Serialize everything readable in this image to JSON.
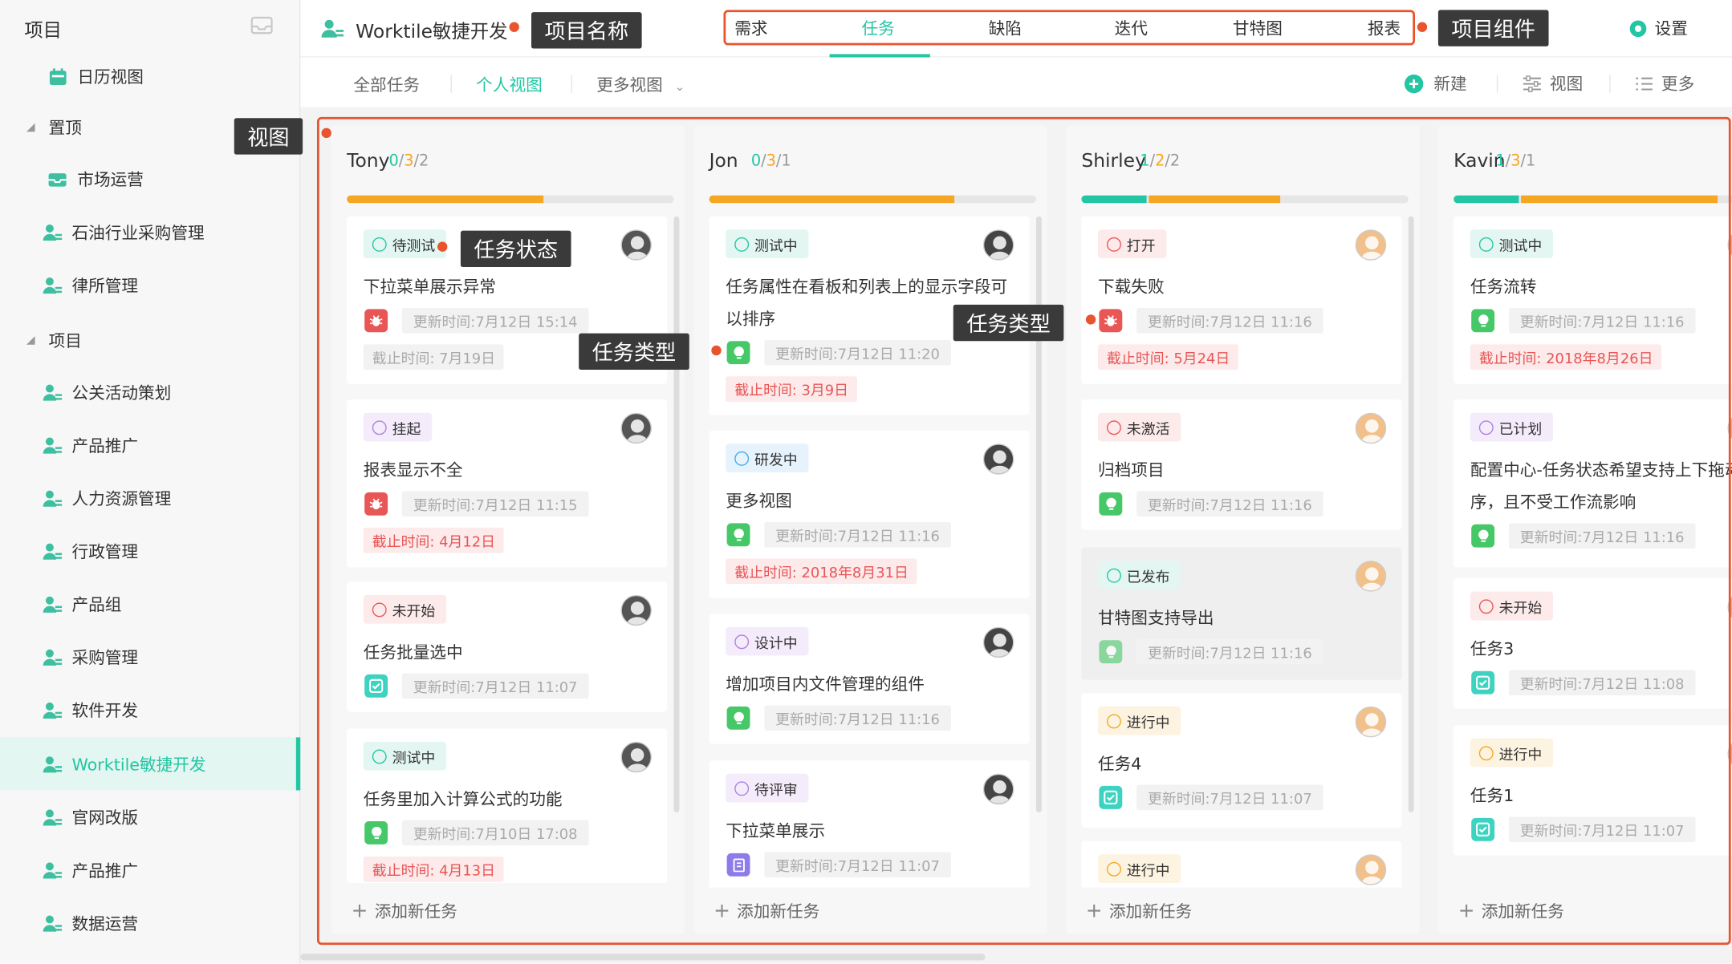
{
  "sidebar": {
    "header": "项目",
    "items": [
      {
        "label": "日历视图",
        "type": "calendar"
      },
      {
        "label": "置顶",
        "type": "group"
      },
      {
        "label": "市场运营",
        "type": "box"
      },
      {
        "label": "石油行业采购管理",
        "type": "project"
      },
      {
        "label": "律所管理",
        "type": "project"
      },
      {
        "label": "项目",
        "type": "group"
      },
      {
        "label": "公关活动策划",
        "type": "project"
      },
      {
        "label": "产品推广",
        "type": "project"
      },
      {
        "label": "人力资源管理",
        "type": "project"
      },
      {
        "label": "行政管理",
        "type": "project"
      },
      {
        "label": "产品组",
        "type": "project"
      },
      {
        "label": "采购管理",
        "type": "project"
      },
      {
        "label": "软件开发",
        "type": "project"
      },
      {
        "label": "Worktile敏捷开发",
        "type": "project",
        "active": true
      },
      {
        "label": "官网改版",
        "type": "project"
      },
      {
        "label": "产品推广",
        "type": "project"
      },
      {
        "label": "数据运营",
        "type": "project"
      }
    ]
  },
  "header": {
    "project_title": "Worktile敏捷开发",
    "nav": [
      "需求",
      "任务",
      "缺陷",
      "迭代",
      "甘特图",
      "报表"
    ],
    "active_nav": "任务",
    "settings": "设置"
  },
  "subheader": {
    "tabs": [
      "全部任务",
      "个人视图",
      "更多视图"
    ],
    "active_tab": "个人视图",
    "new": "新建",
    "view": "视图",
    "more": "更多"
  },
  "callouts": {
    "project_name": "项目名称",
    "project_components": "项目组件",
    "view": "视图",
    "task_status": "任务状态",
    "task_type": "任务类型"
  },
  "add_task": "添加新任务",
  "columns": [
    {
      "name": "Tony",
      "counts": [
        "0",
        "3",
        "2"
      ],
      "avatar": "tony",
      "cards": [
        {
          "status": "待测试",
          "status_color": "teal",
          "title": "下拉菜单展示异常",
          "type": "bug",
          "updated": "更新时间:7月12日 15:14",
          "due": "截止时间: 7月19日",
          "due_style": "grey"
        },
        {
          "status": "挂起",
          "status_color": "purple",
          "title": "报表显示不全",
          "type": "bug",
          "updated": "更新时间:7月12日 11:15",
          "due": "截止时间: 4月12日",
          "due_style": "red"
        },
        {
          "status": "未开始",
          "status_color": "red",
          "title": "任务批量选中",
          "type": "task",
          "updated": "更新时间:7月12日 11:07",
          "due": "",
          "due_style": ""
        },
        {
          "status": "测试中",
          "status_color": "teal",
          "title": "任务里加入计算公式的功能",
          "type": "story",
          "updated": "更新时间:7月10日 17:08",
          "due": "截止时间: 4月13日",
          "due_style": "red"
        }
      ]
    },
    {
      "name": "Jon",
      "counts": [
        "0",
        "3",
        "1"
      ],
      "avatar": "jon",
      "cards": [
        {
          "status": "测试中",
          "status_color": "teal",
          "title": "任务属性在看板和列表上的显示字段可以排序",
          "type": "story",
          "updated": "更新时间:7月12日 11:20",
          "due": "截止时间: 3月9日",
          "due_style": "red"
        },
        {
          "status": "研发中",
          "status_color": "blue",
          "title": "更多视图",
          "type": "story",
          "updated": "更新时间:7月12日 11:16",
          "due": "截止时间: 2018年8月31日",
          "due_style": "red"
        },
        {
          "status": "设计中",
          "status_color": "purple",
          "title": "增加项目内文件管理的组件",
          "type": "story",
          "updated": "更新时间:7月12日 11:16",
          "due": "",
          "due_style": ""
        },
        {
          "status": "待评审",
          "status_color": "purple",
          "title": "下拉菜单展示",
          "type": "doc",
          "updated": "更新时间:7月12日 11:07",
          "due": "",
          "due_style": ""
        }
      ]
    },
    {
      "name": "Shirley",
      "counts": [
        "1",
        "2",
        "2"
      ],
      "avatar": "shirley",
      "cards": [
        {
          "status": "打开",
          "status_color": "red",
          "title": "下载失败",
          "type": "bug",
          "updated": "更新时间:7月12日 11:16",
          "due": "截止时间: 5月24日",
          "due_style": "red"
        },
        {
          "status": "未激活",
          "status_color": "red",
          "title": "归档项目",
          "type": "story",
          "updated": "更新时间:7月12日 11:16",
          "due": "",
          "due_style": ""
        },
        {
          "status": "已发布",
          "status_color": "teal",
          "title": "甘特图支持导出",
          "type": "story",
          "updated": "更新时间:7月12日 11:16",
          "due": "",
          "due_style": "",
          "dim": true
        },
        {
          "status": "进行中",
          "status_color": "amber",
          "title": "任务4",
          "type": "task",
          "updated": "更新时间:7月12日 11:07",
          "due": "",
          "due_style": ""
        },
        {
          "status": "进行中",
          "status_color": "amber",
          "title": "",
          "type": "",
          "updated": "",
          "due": "",
          "due_style": ""
        }
      ]
    },
    {
      "name": "Kavin",
      "counts": [
        "1",
        "3",
        "1"
      ],
      "avatar": "kavin",
      "cards": [
        {
          "status": "测试中",
          "status_color": "teal",
          "title": "任务流转",
          "type": "story",
          "updated": "更新时间:7月12日 11:16",
          "due": "截止时间: 2018年8月26日",
          "due_style": "red"
        },
        {
          "status": "已计划",
          "status_color": "purple",
          "title": "配置中心-任务状态希望支持上下拖动排序，且不受工作流影响",
          "type": "story",
          "updated": "更新时间:7月12日 11:16",
          "due": "",
          "due_style": ""
        },
        {
          "status": "未开始",
          "status_color": "red",
          "title": "任务3",
          "type": "task",
          "updated": "更新时间:7月12日 11:08",
          "due": "",
          "due_style": ""
        },
        {
          "status": "进行中",
          "status_color": "amber",
          "title": "任务1",
          "type": "task",
          "updated": "更新时间:7月12日 11:07",
          "due": "",
          "due_style": ""
        }
      ]
    }
  ],
  "colors": {
    "accent": "#22c6a3",
    "outline": "#e8542e",
    "amber": "#f5a623",
    "red": "#e85656",
    "purple": "#b07de3",
    "blue": "#4aa8e8"
  }
}
